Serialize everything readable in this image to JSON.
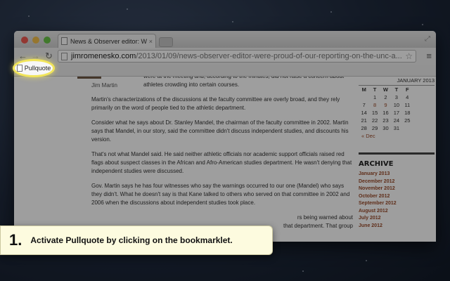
{
  "browser": {
    "tab_title": "News & Observer editor: We",
    "tab_close": "×",
    "url_host": "jimromenesko.com",
    "url_path": "/2013/01/09/news-observer-editor-were-proud-of-our-reporting-on-the-unc-a...",
    "nav_back": "←",
    "nav_forward": "→",
    "nav_reload": "↻",
    "star_glyph": "☆",
    "menu_glyph": "≡",
    "resize_glyph": "⤢"
  },
  "bookmarks": [
    {
      "label": "Pullquote"
    }
  ],
  "article": {
    "photo_caption": "Jim Martin",
    "paragraphs": [
      "were at the meeting and, according to the minutes, did not raise a concern about athletes crowding into certain courses.",
      "Martin's characterizations of the discussions at the faculty committee are overly broad, and they rely primarily on the word of people tied to the athletic department.",
      "Consider what he says about Dr. Stanley Mandel, the chairman of the faculty committee in 2002. Martin says that Mandel, in our story, said the committee didn't discuss independent studies, and discounts his version.",
      "That's not what Mandel said. He said neither athletic officials nor academic support officials raised red flags about suspect classes in the African and Afro-American studies department. He wasn't denying that independent studies were discussed.",
      "Gov. Martin says he has four witnesses who say the warnings occurred to our one (Mandel) who says they didn't. What he doesn't say is that Kane talked to others who served on that committee in 2002 and 2006 when the discussions about independent studies took place.",
      "rs being warned about",
      "that department. That group"
    ]
  },
  "sidebar": {
    "calendar": {
      "title": "JANUARY 2013",
      "weekdays": [
        "M",
        "T",
        "W",
        "T",
        "F"
      ],
      "rows": [
        [
          "",
          "1",
          "2",
          "3",
          "4"
        ],
        [
          "7",
          "8",
          "9",
          "10",
          "11"
        ],
        [
          "14",
          "15",
          "16",
          "17",
          "18"
        ],
        [
          "21",
          "22",
          "23",
          "24",
          "25"
        ],
        [
          "28",
          "29",
          "30",
          "31",
          ""
        ]
      ],
      "prev_link": "« Dec"
    },
    "archive_heading": "ARCHIVE",
    "archive_items": [
      "January 2013",
      "December 2012",
      "November 2012",
      "October 2012",
      "September 2012",
      "August 2012",
      "July 2012",
      "June 2012"
    ]
  },
  "callout": {
    "step_number": "1.",
    "instruction": "Activate Pullquote by clicking on the bookmarklet."
  },
  "colors": {
    "highlight": "#f1e55a",
    "callout_bg": "#fdfbdf",
    "link": "#9a4b2a"
  }
}
